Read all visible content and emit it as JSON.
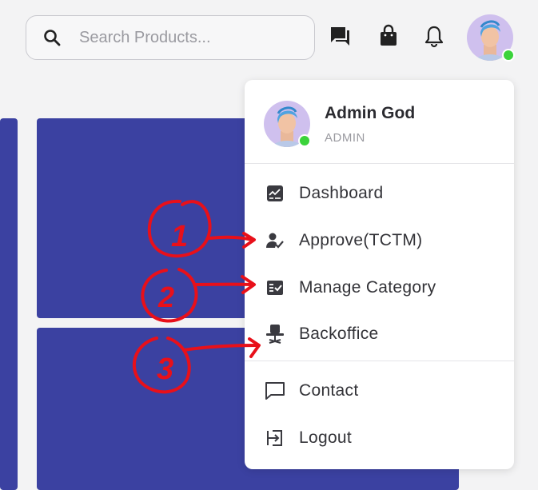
{
  "search": {
    "placeholder": "Search Products..."
  },
  "header_icons": [
    "chat-icon",
    "shopping-bag-icon",
    "bell-icon"
  ],
  "user": {
    "name": "Admin God",
    "role": "ADMIN",
    "status_color": "#3bd33b"
  },
  "menu": {
    "items": [
      {
        "label": "Dashboard",
        "icon": "dashboard-icon"
      },
      {
        "label": "Approve(TCTM)",
        "icon": "user-check-icon"
      },
      {
        "label": "Manage Category",
        "icon": "checklist-icon"
      },
      {
        "label": "Backoffice",
        "icon": "office-chair-icon"
      },
      {
        "label": "Contact",
        "icon": "message-icon"
      },
      {
        "label": "Logout",
        "icon": "logout-icon"
      }
    ]
  },
  "annotations": [
    "1",
    "2",
    "3"
  ],
  "colors": {
    "accent": "#3b41a1",
    "annotation": "#e8101a",
    "background": "#f3f3f4"
  }
}
